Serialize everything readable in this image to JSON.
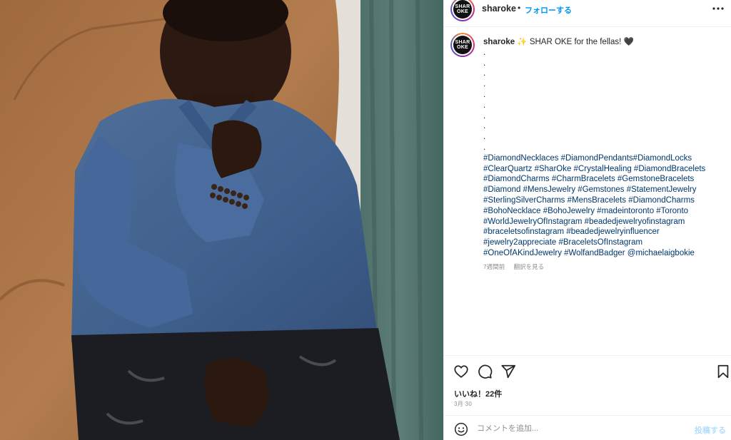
{
  "header": {
    "username": "sharoke",
    "separator": "•",
    "follow_label": "フォローする",
    "avatar_text_line1": "SHAR",
    "avatar_text_line2": "OKE"
  },
  "caption": {
    "username": "sharoke",
    "text": " ✨ SHAR OKE for the fellas! 🖤",
    "dot_lines": [
      ".",
      ".",
      ".",
      ".",
      ".",
      ".",
      ".",
      ".",
      ".",
      "."
    ],
    "tag_lines": [
      "#DiamondNecklaces #DiamondPendants#DiamondLocks",
      "#ClearQuartz #SharOke #CrystalHealing #DiamondBracelets",
      "#DiamondCharms #CharmBracelets #GemstoneBracelets",
      "#Diamond #MensJewelry #Gemstones #StatementJewelry",
      "#SterlingSilverCharms #MensBracelets #DiamondCharms",
      "#BohoNecklace #BohoJewelry #madeintoronto #Toronto",
      "#WorldJewelryOfInstagram #beadedjewelryofinstagram",
      "#braceletsofinstagram #beadedjewelryinfluencer",
      "#jewelry2appreciate #BraceletsOfInstagram",
      "#OneOfAKindJewelry #WolfandBadger @michaelaigbokie"
    ],
    "time_ago": "7週間前",
    "translate_label": "翻訳を見る"
  },
  "actions": {
    "like_icon": "heart-icon",
    "comment_icon": "comment-icon",
    "share_icon": "send-icon",
    "save_icon": "bookmark-icon",
    "likes_text": "いいね！22件",
    "date_text": "3月 30"
  },
  "comment": {
    "placeholder": "コメントを追加...",
    "post_label": "投稿する"
  },
  "colors": {
    "link": "#00376b",
    "follow": "#0095f6",
    "post_disabled": "#b2dffc",
    "muted": "#8e8e8e"
  }
}
